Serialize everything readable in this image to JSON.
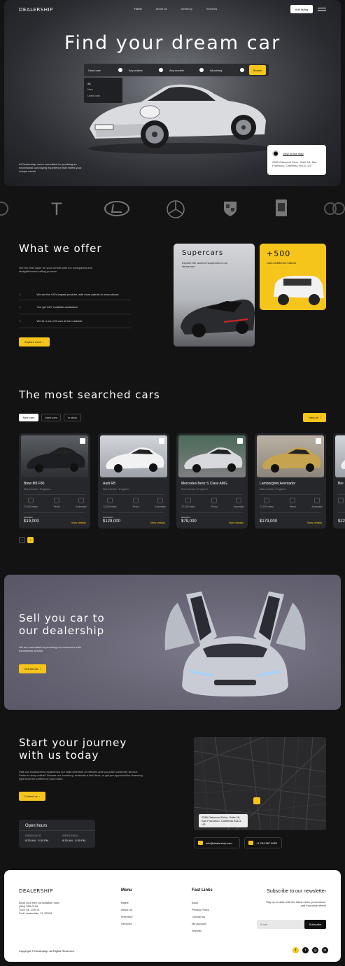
{
  "brand": "DEALERSHIP",
  "nav": {
    "links": [
      "Home",
      "About us",
      "Inventory",
      "Services"
    ],
    "cta": "Add listing"
  },
  "hero": {
    "title": "Find your dream car",
    "filters": [
      "Used cars",
      "Any makes",
      "Any models",
      "All pricing"
    ],
    "search": "Search",
    "dropdown": [
      "All",
      "New",
      "Used cars"
    ],
    "intro": "At Dealership, we're committed to providing an exceptional car-buying experience that meets your unique needs",
    "map_link": "View on the map",
    "address": "2389 Oakwood Drive, Suite 18, San Francisco, California 94111, US"
  },
  "offer": {
    "title": "What we offer",
    "desc": "Get the best value for your vehicle with our transparent and straightforward selling process",
    "items": [
      "We are the US's largest provider, with more patrols in more places",
      "You get 24/7 roadside assistance",
      "We fix 4 out of 5 cars at the roadside"
    ],
    "btn": "Explore more",
    "card1_title": "Supercars",
    "card1_desc": "Explore the world of supercars in our showroom",
    "card2_title": "+500",
    "card2_desc": "Cars of different brands"
  },
  "searched": {
    "title": "The most searched cars",
    "tabs": [
      "New cars",
      "Used cars",
      "In stock"
    ],
    "view_all": "View all",
    "cars": [
      {
        "name": "Bmw M3 F80",
        "loc": "Manchester, England",
        "miles": "72,029 miles",
        "fuel": "Petrol",
        "trans": "Automatic",
        "old": "$24,000",
        "price": "$19,000",
        "link": "View details"
      },
      {
        "name": "Audi R8",
        "loc": "Manchester, England",
        "miles": "72,029 miles",
        "fuel": "Petrol",
        "trans": "Automatic",
        "old": "$134,000",
        "price": "$129,000",
        "link": "View details"
      },
      {
        "name": "Mercedes Benz S Class AMG",
        "loc": "Manchester, England",
        "miles": "72,029 miles",
        "fuel": "Petrol",
        "trans": "Automatic",
        "old": "$84,000",
        "price": "$79,000",
        "link": "View details"
      },
      {
        "name": "Lamborghini Aventador",
        "loc": "Manchester, England",
        "miles": "72,029 miles",
        "fuel": "Petrol",
        "trans": "Automatic",
        "old": "",
        "price": "$179,000",
        "link": "View details"
      },
      {
        "name": "Bre",
        "price": "$22,"
      }
    ]
  },
  "sell": {
    "title_l1": "Sell you car to",
    "title_l2": "our dealership",
    "desc": "We are committed to providing our customers with exceptional service.",
    "btn": "Sell the car"
  },
  "journey": {
    "title_l1": "Start your journey",
    "title_l2": "with us today",
    "desc": "Visit our showroom to experience our wide selection of vehicles and top-notch customer service. Prefer to shop online? Browse our inventory, schedule a test drive, or get pre-approved for financing right from the comfort of your home.",
    "btn": "Contact us",
    "hours_title": "Open hours",
    "weekdays": "WEEKDAYS",
    "weekdays_time": "8:30 AM - 5:30 PM",
    "weekends": "WEEKENDS",
    "weekends_time": "8:30 AM - 5:30 PM",
    "map_addr": "2389 Oakwood Drive, Suite 18, San Francisco, California 94111, US",
    "email": "info@dealership.com",
    "phone": "+1 234 567 8900"
  },
  "footer": {
    "brand": "DEALERSHIP",
    "contact": [
      "Book your free consultation now!",
      "(954) 555-0189",
      "1924 SE 17th St",
      "Fort Lauderdale, FL 33316"
    ],
    "menu_title": "Menu",
    "menu": [
      "Home",
      "About us",
      "Inventory",
      "Services"
    ],
    "links_title": "Fast Links",
    "links": [
      "Book",
      "Privacy Policy",
      "Contact us",
      "My account",
      "Wishlist"
    ],
    "news_title": "Subscribe to our newsletter",
    "news_desc": "Stay up to date with the latest news, promotions, and exclusive offers!",
    "email_placeholder": "Email",
    "subscribe": "Subscribe",
    "copyright": "Copyright © Dealership. All Rights Reserved."
  },
  "colors": {
    "accent": "#f5c51c",
    "bg": "#131313"
  }
}
